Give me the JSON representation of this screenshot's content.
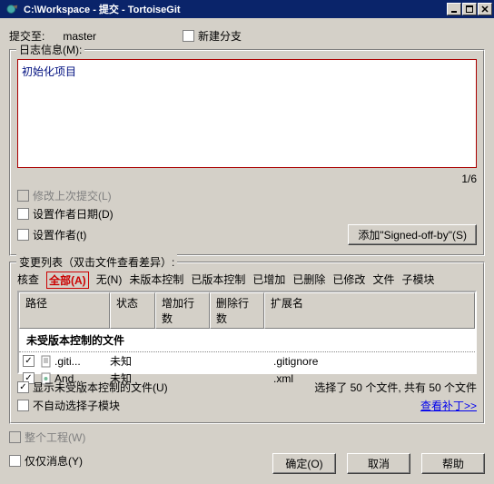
{
  "window": {
    "title": "C:\\Workspace - 提交 - TortoiseGit"
  },
  "commit_to": {
    "label": "提交至:",
    "branch": "master",
    "new_branch": "新建分支"
  },
  "log": {
    "group_label": "日志信息(M):",
    "message": "初始化项目",
    "counter": "1/6",
    "amend": "修改上次提交(L)",
    "set_date": "设置作者日期(D)",
    "set_author": "设置作者(t)",
    "signoff_btn": "添加\"Signed-off-by\"(S)"
  },
  "changes": {
    "group_label": "变更列表（双击文件查看差异）:",
    "tabs": {
      "check": "核查",
      "all": "全部(A)",
      "none": "无(N)",
      "unversioned": "未版本控制",
      "versioned": "已版本控制",
      "added": "已增加",
      "deleted": "已删除",
      "modified": "已修改",
      "files": "文件",
      "submodules": "子模块"
    },
    "columns": {
      "path": "路径",
      "status": "状态",
      "add_lines": "增加行数",
      "del_lines": "删除行数",
      "ext": "扩展名"
    },
    "section": "未受版本控制的文件",
    "rows": [
      {
        "name": ".giti...",
        "status": "未知",
        "ext": ".gitignore"
      },
      {
        "name": "And...",
        "status": "未知",
        "ext": ".xml"
      }
    ],
    "show_unversioned": "显示未受版本控制的文件(U)",
    "no_auto_submod": "不自动选择子模块",
    "summary": "选择了 50 个文件, 共有 50 个文件",
    "view_patch": "查看补丁>>"
  },
  "bottom": {
    "whole_project": "整个工程(W)",
    "msg_only": "仅仅消息(Y)",
    "ok": "确定(O)",
    "cancel": "取消",
    "help": "帮助"
  }
}
